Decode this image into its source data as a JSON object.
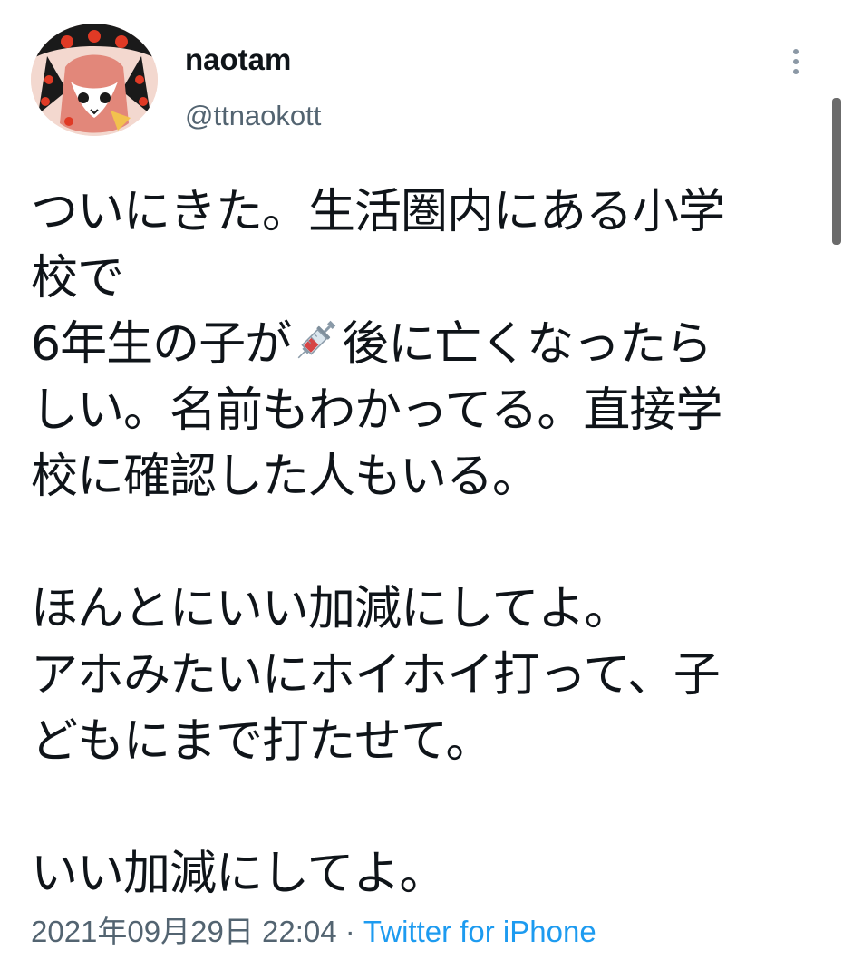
{
  "author": {
    "display_name": "naotam",
    "handle": "@ttnaokott",
    "avatar_icon": "cat-avatar-icon"
  },
  "menu": {
    "more_icon": "more-vertical-icon"
  },
  "tweet": {
    "lines": [
      "ついにきた。生活圏内にある小学",
      "校で",
      "6年生の子が",
      "後に亡くなったら",
      "しい。名前もわかってる。直接学",
      "校に確認した人もいる。",
      "ほんとにいい加減にしてよ。",
      "アホみたいにホイホイ打って、子",
      "どもにまで打たせて。",
      "いい加減にしてよ。"
    ],
    "emoji_icon": "syringe-icon"
  },
  "meta": {
    "timestamp": "2021年09月29日 22:04",
    "separator": " · ",
    "source": "Twitter for iPhone"
  },
  "colors": {
    "text": "#0f1419",
    "secondary": "#536471",
    "link": "#1d9bf0"
  }
}
